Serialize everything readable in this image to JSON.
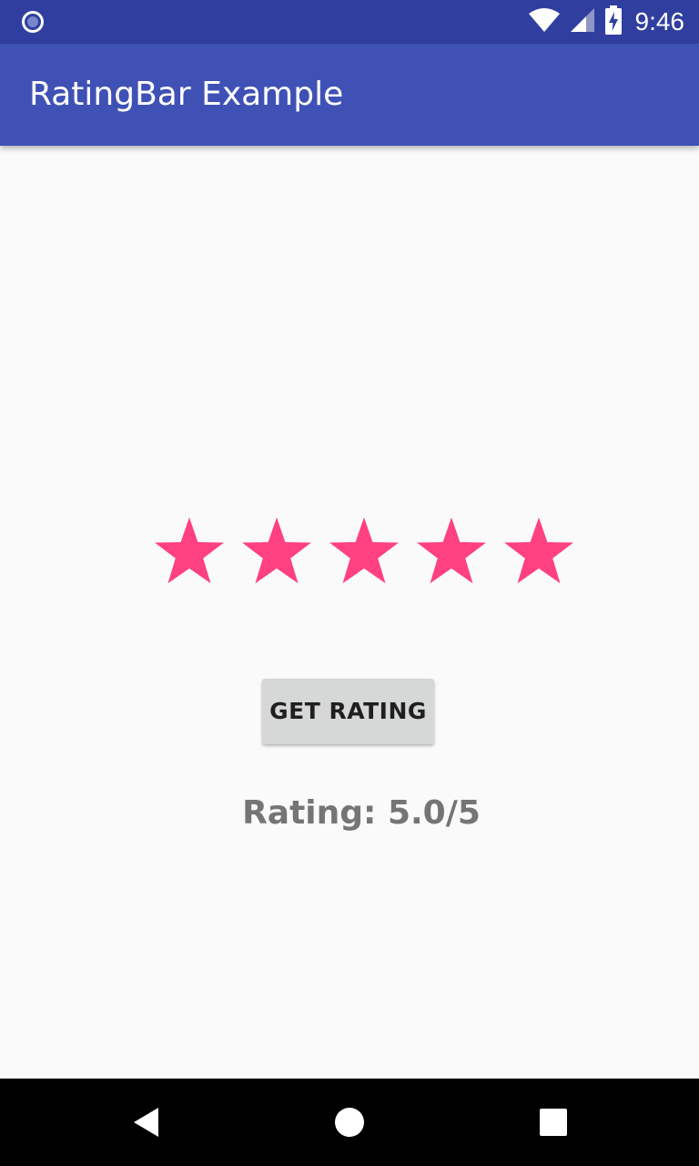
{
  "status_bar": {
    "time": "9:46",
    "icons": [
      "notification-circle-icon",
      "wifi-icon",
      "cell-signal-icon",
      "battery-charging-icon"
    ]
  },
  "app_bar": {
    "title": "RatingBar Example"
  },
  "rating_bar": {
    "rating": 5,
    "max": 5,
    "star_color": "#ff4081"
  },
  "button": {
    "label": "GET RATING"
  },
  "rating_text": "Rating: 5.0/5",
  "nav_bar": {
    "icons": [
      "back-icon",
      "home-icon",
      "recents-icon"
    ]
  },
  "colors": {
    "status_bar": "#303f9f",
    "app_bar": "#3f51b5",
    "background": "#fafafa",
    "star": "#ff4081"
  }
}
